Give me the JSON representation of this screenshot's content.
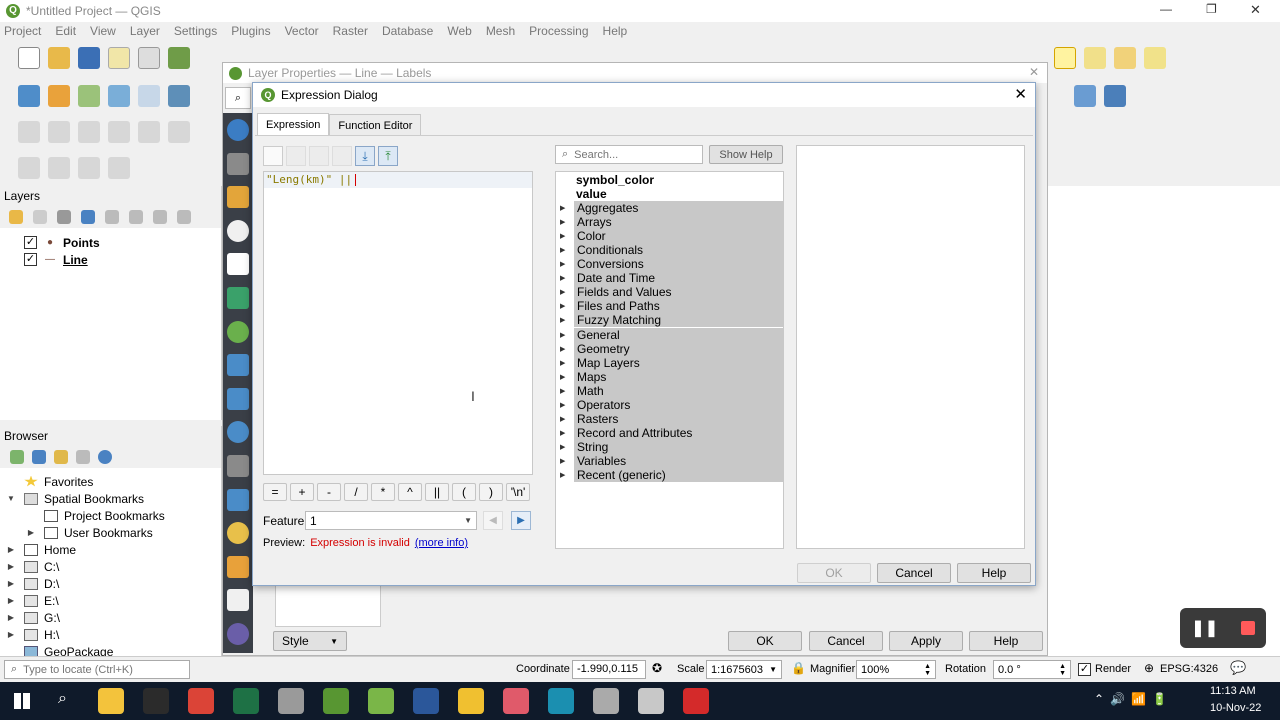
{
  "window": {
    "title": "*Untitled Project — QGIS",
    "controls": {
      "minimize": "—",
      "maximize": "❐",
      "close": "✕"
    }
  },
  "menubar": [
    "Project",
    "Edit",
    "View",
    "Layer",
    "Settings",
    "Plugins",
    "Vector",
    "Raster",
    "Database",
    "Web",
    "Mesh",
    "Processing",
    "Help"
  ],
  "layers_panel": {
    "title": "Layers",
    "items": [
      {
        "label": "Points",
        "checked": true,
        "symbol": "●"
      },
      {
        "label": "Line",
        "checked": true,
        "symbol": "—"
      }
    ]
  },
  "browser_panel": {
    "title": "Browser",
    "items": [
      {
        "label": "Favorites",
        "icon": "star-icon",
        "level": 0,
        "expander": ""
      },
      {
        "label": "Spatial Bookmarks",
        "icon": "bookmark-icon",
        "level": 0,
        "expander": "▼"
      },
      {
        "label": "Project Bookmarks",
        "icon": "folder-icon",
        "level": 1,
        "expander": ""
      },
      {
        "label": "User Bookmarks",
        "icon": "folder-icon",
        "level": 1,
        "expander": "▶"
      },
      {
        "label": "Home",
        "icon": "home-icon",
        "level": 0,
        "expander": "▶"
      },
      {
        "label": "C:\\",
        "icon": "drive-icon",
        "level": 0,
        "expander": "▶"
      },
      {
        "label": "D:\\",
        "icon": "drive-icon",
        "level": 0,
        "expander": "▶"
      },
      {
        "label": "E:\\",
        "icon": "drive-icon",
        "level": 0,
        "expander": "▶"
      },
      {
        "label": "G:\\",
        "icon": "drive-icon",
        "level": 0,
        "expander": "▶"
      },
      {
        "label": "H:\\",
        "icon": "drive-icon",
        "level": 0,
        "expander": "▶"
      },
      {
        "label": "GeoPackage",
        "icon": "geopackage-icon",
        "level": 0,
        "expander": ""
      }
    ]
  },
  "layer_properties": {
    "title": "Layer Properties — Line — Labels",
    "style_label": "Style",
    "buttons": {
      "ok": "OK",
      "cancel": "Cancel",
      "apply": "Apply",
      "help": "Help"
    }
  },
  "expression_dialog": {
    "title": "Expression Dialog",
    "tabs": [
      {
        "label": "Expression",
        "active": true
      },
      {
        "label": "Function Editor",
        "active": false
      }
    ],
    "expression_text": "\"Leng(km)\" ||",
    "search_placeholder": "Search...",
    "show_help_label": "Show Help",
    "fields": [
      "symbol_color",
      "value"
    ],
    "groups": [
      "Aggregates",
      "Arrays",
      "Color",
      "Conditionals",
      "Conversions",
      "Date and Time",
      "Fields and Values",
      "Files and Paths",
      "Fuzzy Matching",
      "General",
      "Geometry",
      "Map Layers",
      "Maps",
      "Math",
      "Operators",
      "Rasters",
      "Record and Attributes",
      "String",
      "Variables",
      "Recent (generic)"
    ],
    "operators": [
      "=",
      "+",
      "-",
      "/",
      "*",
      "^",
      "||",
      "(",
      ")",
      "'\\n'"
    ],
    "feature_label": "Feature",
    "feature_value": "1",
    "preview_label": "Preview:",
    "preview_error": "Expression is invalid",
    "more_info": "(more info)",
    "buttons": {
      "ok": "OK",
      "cancel": "Cancel",
      "help": "Help"
    }
  },
  "statusbar": {
    "locate_placeholder": "Type to locate (Ctrl+K)",
    "coordinate_label": "Coordinate",
    "coordinate_value": "-1.990,0.115",
    "scale_label": "Scale",
    "scale_value": "1:1675603",
    "magnifier_label": "Magnifier",
    "magnifier_value": "100%",
    "rotation_label": "Rotation",
    "rotation_value": "0.0 °",
    "render_label": "Render",
    "crs": "EPSG:4326"
  },
  "taskbar": {
    "time": "11:13 AM",
    "date": "10-Nov-22"
  },
  "colors": {
    "accent_selection": "#cce4f7",
    "function_group_bg": "#c8c8c8",
    "error_red": "#d40000",
    "link_blue": "#0000cc",
    "expression_string": "#8a7a00",
    "qgis_green": "#589632",
    "taskbar_bg": "#0f1a2a"
  }
}
